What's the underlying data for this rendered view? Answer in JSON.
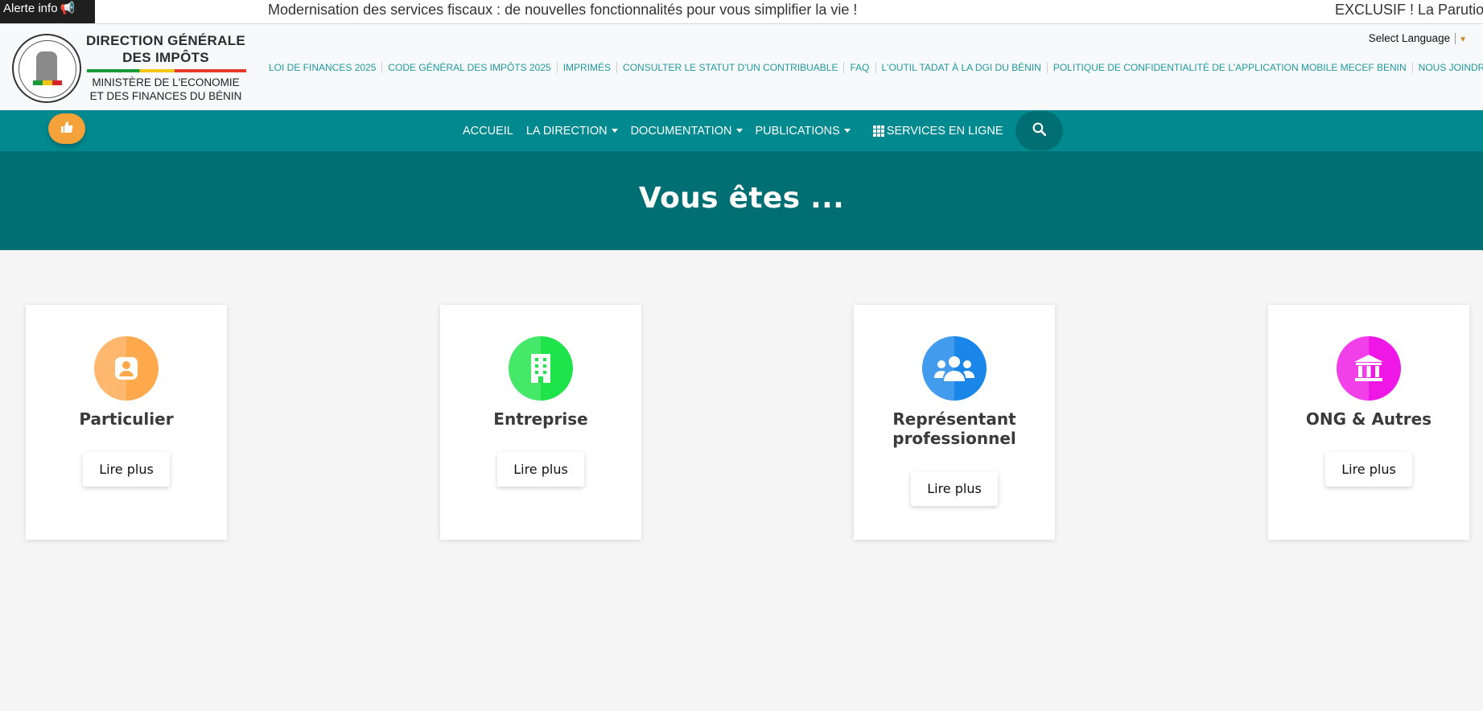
{
  "alert": {
    "label": "Alerte info",
    "icon": "megaphone-icon",
    "ticker": [
      "Modernisation des services fiscaux : de nouvelles fonctionnalités pour vous simplifier la vie !",
      "EXCLUSIF ! La Parution"
    ]
  },
  "brand": {
    "line1": "DIRECTION GÉNÉRALE",
    "line2": "DES IMPÔTS",
    "line3": "MINISTÈRE DE L'ECONOMIE",
    "line4": "ET DES FINANCES DU BÉNIN"
  },
  "toplinks": [
    "LOI DE FINANCES 2025",
    "CODE GÉNÉRAL DES IMPÔTS 2025",
    "IMPRIMÉS",
    "CONSULTER LE STATUT D'UN CONTRIBUABLE",
    "FAQ",
    "L'OUTIL TADAT À LA DGI DU BÉNIN",
    "POLITIQUE DE CONFIDENTIALITÉ DE L'APPLICATION MOBILE MECEF BENIN",
    "NOUS JOINDRE"
  ],
  "language": {
    "label": "Select Language"
  },
  "nav": {
    "items": [
      "ACCUEIL",
      "LA DIRECTION",
      "DOCUMENTATION",
      "PUBLICATIONS",
      "SERVICES EN LIGNE"
    ]
  },
  "hero": {
    "title": "Vous êtes ..."
  },
  "cards": [
    {
      "title": "Particulier",
      "button": "Lire plus",
      "color": "#ffa94d",
      "icon": "user-icon"
    },
    {
      "title": "Entreprise",
      "button": "Lire plus",
      "color": "#1ee34a",
      "icon": "building-icon"
    },
    {
      "title": "Représentant professionnel",
      "button": "Lire plus",
      "color": "#1a86ea",
      "icon": "users-icon"
    },
    {
      "title": "ONG & Autres",
      "button": "Lire plus",
      "color": "#ee17e6",
      "icon": "institution-icon"
    }
  ],
  "colors": {
    "teal_nav": "#00898e",
    "teal_dark": "#006f73",
    "link": "#1e9aa0",
    "like_button": "#f5a23a"
  }
}
